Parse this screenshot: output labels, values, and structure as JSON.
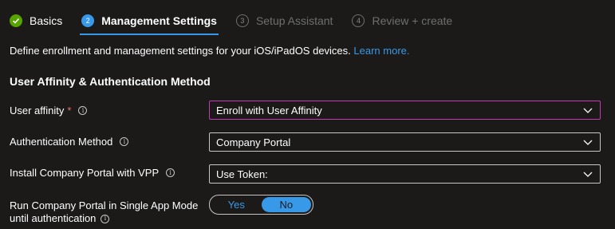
{
  "wizard": {
    "steps": [
      {
        "number": "✓",
        "label": "Basics",
        "state": "done"
      },
      {
        "number": "2",
        "label": "Management Settings",
        "state": "active"
      },
      {
        "number": "3",
        "label": "Setup Assistant",
        "state": "disabled"
      },
      {
        "number": "4",
        "label": "Review + create",
        "state": "disabled"
      }
    ]
  },
  "intro": {
    "text": "Define enrollment and management settings for your iOS/iPadOS devices.",
    "link": "Learn more."
  },
  "section": {
    "title": "User Affinity & Authentication Method"
  },
  "fields": {
    "user_affinity": {
      "label": "User affinity",
      "required": "*",
      "value": "Enroll with User Affinity"
    },
    "auth_method": {
      "label": "Authentication Method",
      "value": "Company Portal"
    },
    "install_cp": {
      "label": "Install Company Portal with VPP",
      "value": "Use Token:"
    },
    "single_app": {
      "label_line1": "Run Company Portal in Single App Mode",
      "label_line2": "until authentication",
      "options": [
        "Yes",
        "No"
      ],
      "selected": "No"
    }
  },
  "icons": {
    "info": "info-icon",
    "chevron": "chevron-down-icon",
    "check": "checkmark-icon"
  },
  "colors": {
    "accent": "#3899e8",
    "success": "#57a300",
    "focus": "#c239b3",
    "required": "#e8726c"
  }
}
